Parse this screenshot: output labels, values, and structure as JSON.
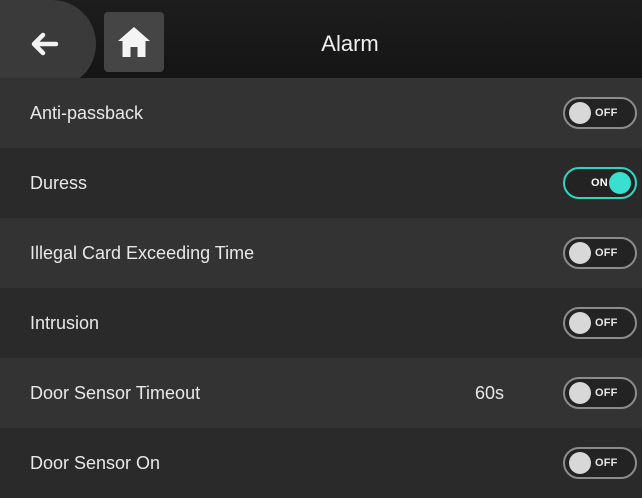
{
  "header": {
    "title": "Alarm",
    "back_icon": "arrow-left-icon",
    "home_icon": "home-icon"
  },
  "colors": {
    "accent_on": "#39e0cf",
    "background": "#2b2b2b",
    "header": "#161616"
  },
  "settings": [
    {
      "label": "Anti-passback",
      "value": "",
      "toggle": "OFF"
    },
    {
      "label": "Duress",
      "value": "",
      "toggle": "ON"
    },
    {
      "label": "Illegal Card Exceeding Time",
      "value": "",
      "toggle": "OFF"
    },
    {
      "label": "Intrusion",
      "value": "",
      "toggle": "OFF"
    },
    {
      "label": "Door Sensor Timeout",
      "value": "60s",
      "toggle": "OFF"
    },
    {
      "label": "Door Sensor On",
      "value": "",
      "toggle": "OFF"
    }
  ]
}
